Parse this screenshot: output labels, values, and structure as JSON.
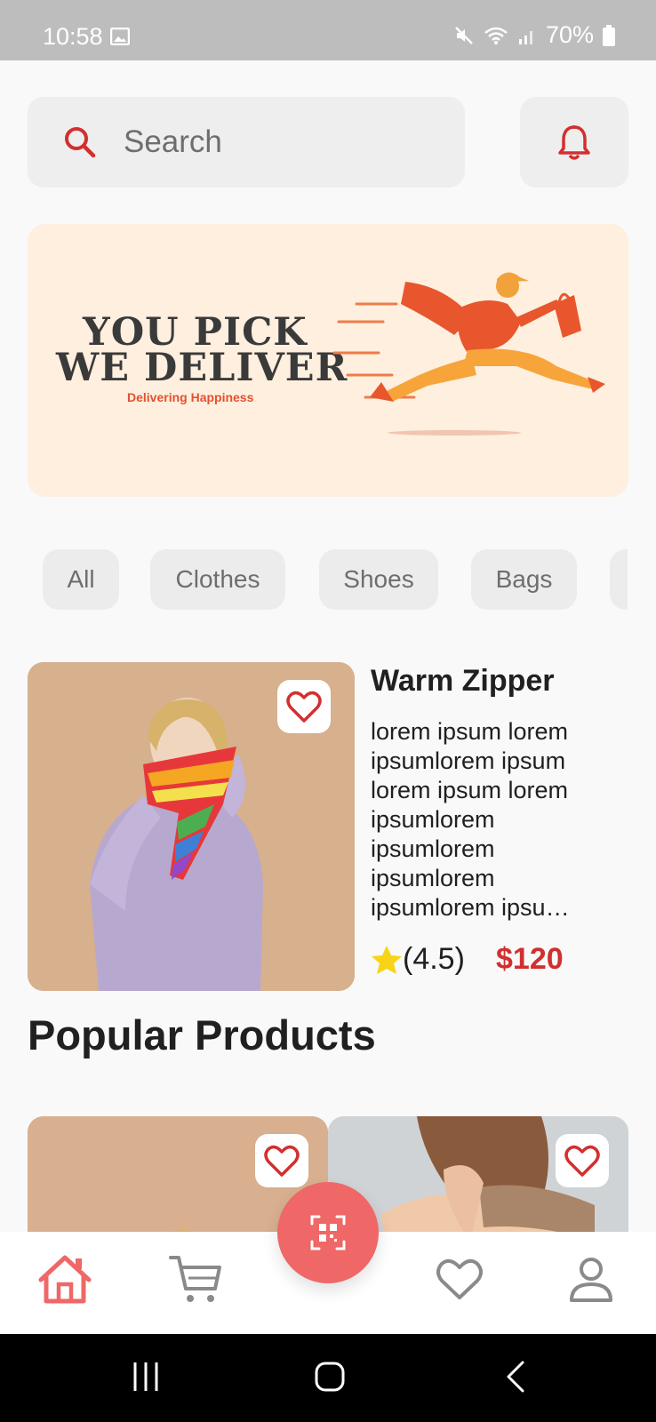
{
  "status_bar": {
    "time": "10:58",
    "battery": "70%",
    "icons": [
      "gallery-icon",
      "mute-icon",
      "wifi-icon",
      "signal-icon",
      "battery-icon"
    ]
  },
  "search": {
    "placeholder": "Search",
    "icon": "search-icon"
  },
  "notifications": {
    "icon": "bell-icon"
  },
  "banner": {
    "line1": "YOU PICK",
    "line2": "WE DELIVER",
    "tagline": "Delivering Happiness"
  },
  "categories": [
    "All",
    "Clothes",
    "Shoes",
    "Bags"
  ],
  "featured_product": {
    "title": "Warm Zipper",
    "description": "lorem ipsum lorem ipsumlorem ipsum lorem ipsum lorem ipsumlorem ipsumlorem ipsumlorem ipsumlorem ipsu…",
    "rating": "(4.5)",
    "price": "$120"
  },
  "popular": {
    "title": "Popular Products"
  },
  "bottom_nav": [
    "home-icon",
    "cart-icon",
    "qr-scan-icon",
    "heart-icon",
    "profile-icon"
  ],
  "colors": {
    "accent": "#d32f2f",
    "fab": "#ef6767",
    "banner_bg": "#feefdf"
  }
}
